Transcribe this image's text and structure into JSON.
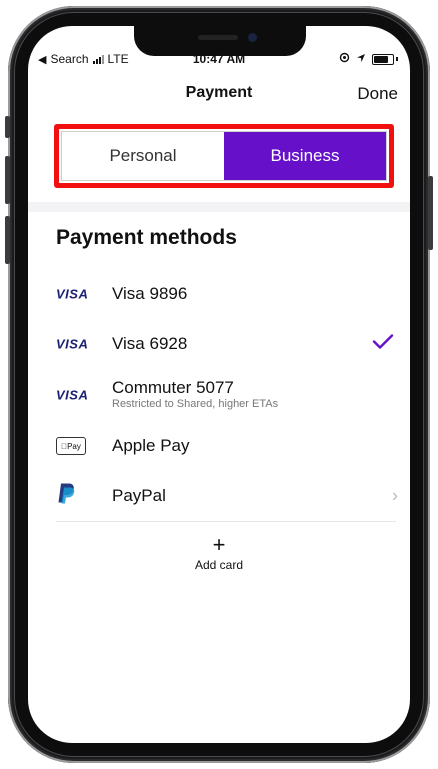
{
  "status_bar": {
    "back_app": "Search",
    "network": "LTE",
    "time": "10:47 AM"
  },
  "nav": {
    "title": "Payment",
    "done": "Done"
  },
  "segment": {
    "options": [
      "Personal",
      "Business"
    ],
    "selected": "Business"
  },
  "section_title": "Payment methods",
  "payment_methods": [
    {
      "brand": "VISA",
      "label": "Visa 9896",
      "sub": "",
      "icon": "visa-logo"
    },
    {
      "brand": "VISA",
      "label": "Visa 6928",
      "sub": "",
      "icon": "visa-logo",
      "selected": true
    },
    {
      "brand": "VISA",
      "label": "Commuter 5077",
      "sub": "Restricted to Shared, higher ETAs",
      "icon": "visa-logo"
    },
    {
      "brand": "Pay",
      "label": "Apple Pay",
      "sub": "",
      "icon": "apple-pay-logo"
    },
    {
      "brand": "",
      "label": "PayPal",
      "sub": "",
      "icon": "paypal-logo"
    }
  ],
  "add_card": {
    "icon": "plus-icon",
    "label": "Add card"
  },
  "colors": {
    "accent": "#6611c9",
    "highlight": "#f20f0f",
    "visa": "#1a1f71",
    "paypal_dark": "#253b80",
    "paypal_light": "#179bd7"
  }
}
